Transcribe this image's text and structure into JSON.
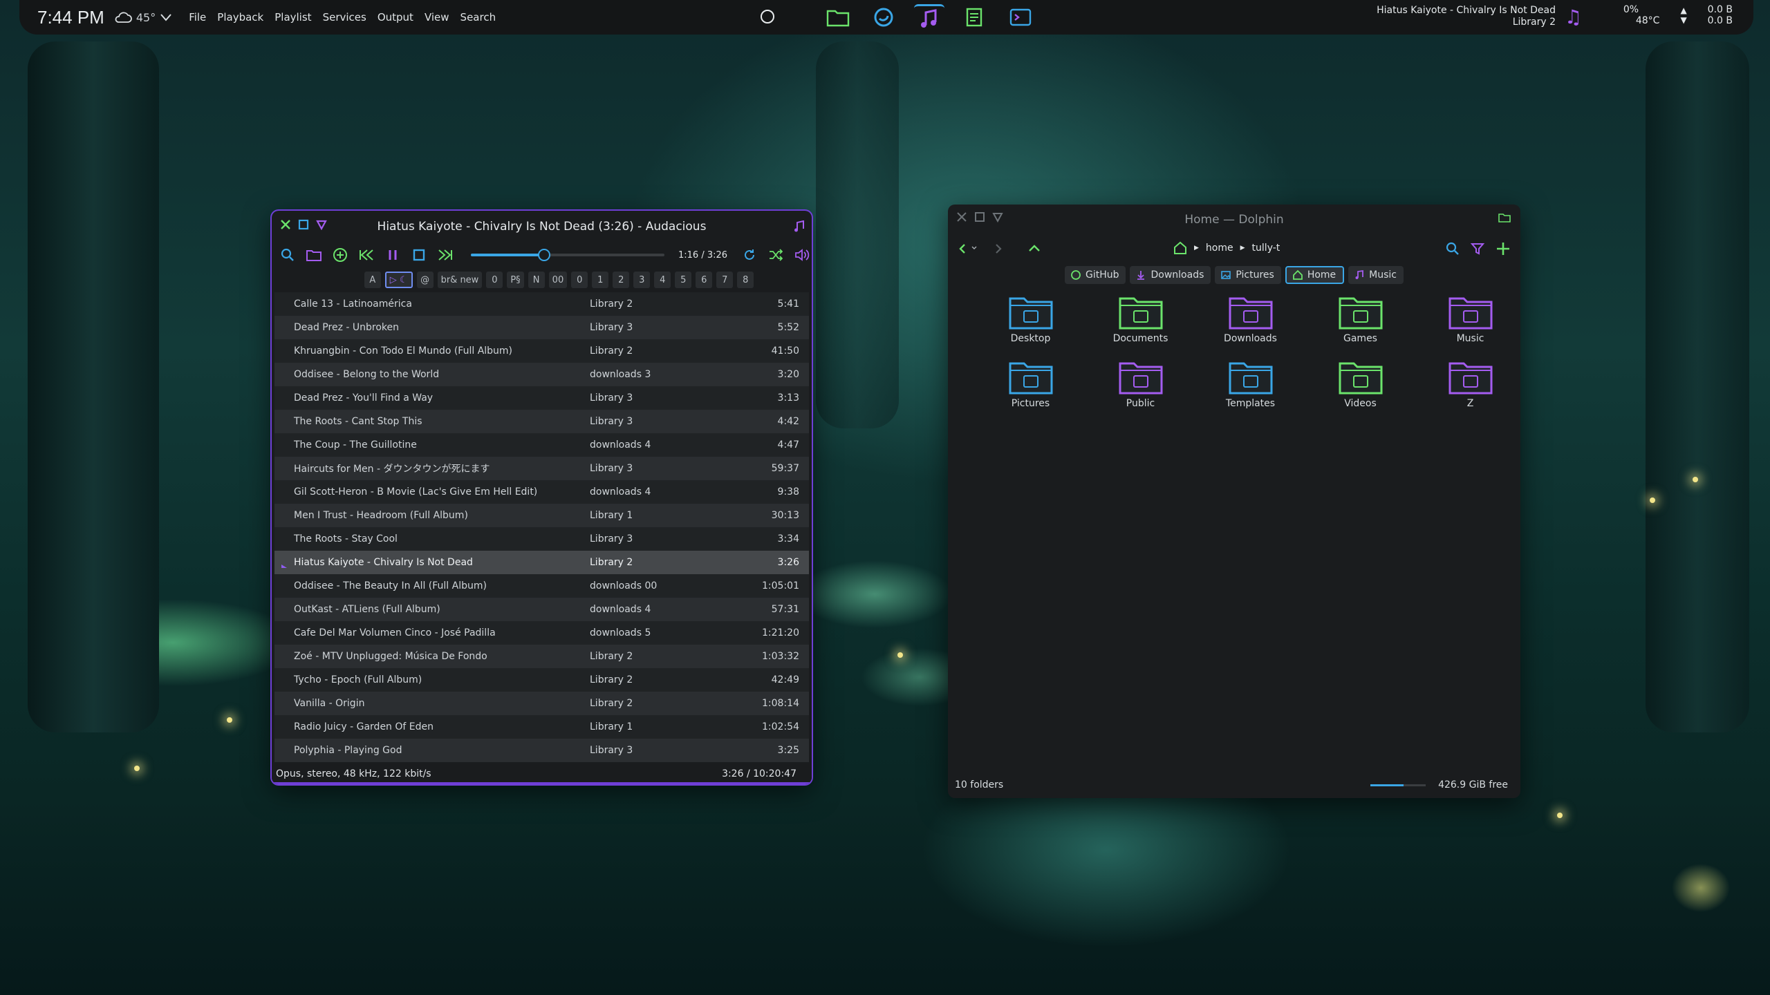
{
  "topbar": {
    "clock": "7:44 PM",
    "weather": "45°",
    "menus": [
      "File",
      "Playback",
      "Playlist",
      "Services",
      "Output",
      "View",
      "Search"
    ],
    "launchers": [
      "folder-icon",
      "browser-icon",
      "music-note-icon",
      "text-editor-icon",
      "terminal-icon"
    ],
    "now_playing_title": "Hiatus Kaiyote - Chivalry Is Not Dead",
    "now_playing_library": "Library 2",
    "cpu": "0%",
    "temp": "48°C",
    "net_up": "0.0 B",
    "net_down": "0.0 B"
  },
  "audacious": {
    "title": "Hiatus Kaiyote - Chivalry Is Not Dead (3:26) - Audacious",
    "time": "1:16 / 3:26",
    "progress_fraction": 0.37,
    "tabs": [
      "A",
      "▷ ☾",
      "@",
      "br& new",
      "0",
      "P§",
      "N",
      "00",
      "0",
      "1",
      "2",
      "3",
      "4",
      "5",
      "6",
      "7",
      "8"
    ],
    "active_tab": 1,
    "playlist": [
      {
        "title": "Calle 13 - Latinoamérica",
        "library": "Library 2",
        "length": "5:41"
      },
      {
        "title": "Dead Prez - Unbroken",
        "library": "Library 3",
        "length": "5:52"
      },
      {
        "title": "Khruangbin - Con Todo El Mundo (Full Album)",
        "library": "Library 2",
        "length": "41:50"
      },
      {
        "title": "Oddisee - Belong to the World",
        "library": "downloads 3",
        "length": "3:20"
      },
      {
        "title": "Dead Prez - You'll Find a Way",
        "library": "Library 3",
        "length": "3:13"
      },
      {
        "title": "The Roots - Cant Stop This",
        "library": "Library 3",
        "length": "4:42"
      },
      {
        "title": "The Coup - The Guillotine",
        "library": "downloads 4",
        "length": "4:47"
      },
      {
        "title": "Haircuts for Men - ダウンタウンが死にます",
        "library": "Library 3",
        "length": "59:37"
      },
      {
        "title": "Gil Scott-Heron - B Movie (Lac's Give Em Hell Edit)",
        "library": "downloads 4",
        "length": "9:38"
      },
      {
        "title": "Men I Trust - Headroom (Full Album)",
        "library": "Library 1",
        "length": "30:13"
      },
      {
        "title": "The Roots - Stay Cool",
        "library": "Library 3",
        "length": "3:34"
      },
      {
        "title": "Hiatus Kaiyote - Chivalry Is Not Dead",
        "library": "Library 2",
        "length": "3:26",
        "playing": true
      },
      {
        "title": "Oddisee - The Beauty In All (Full Album)",
        "library": "downloads 00",
        "length": "1:05:01"
      },
      {
        "title": "OutKast - ATLiens (Full Album)",
        "library": "downloads 4",
        "length": "57:31"
      },
      {
        "title": "Cafe Del Mar Volumen Cinco - José Padilla",
        "library": "downloads 5",
        "length": "1:21:20"
      },
      {
        "title": "Zoé - MTV Unplugged: Música De Fondo",
        "library": "Library 2",
        "length": "1:03:32"
      },
      {
        "title": "Tycho - Epoch (Full Album)",
        "library": "Library 2",
        "length": "42:49"
      },
      {
        "title": "Vanilla - Origin",
        "library": "Library 2",
        "length": "1:08:14"
      },
      {
        "title": "Radio Juicy - Garden Of Eden",
        "library": "Library 1",
        "length": "1:02:54"
      },
      {
        "title": "Polyphia - Playing God",
        "library": "Library 3",
        "length": "3:25"
      }
    ],
    "status_left": "Opus, stereo, 48 kHz, 122 kbit/s",
    "status_right": "3:26 / 10:20:47"
  },
  "dolphin": {
    "title": "Home — Dolphin",
    "breadcrumb": [
      "home",
      "tully-t"
    ],
    "places": [
      {
        "label": "GitHub",
        "icon": "github-icon"
      },
      {
        "label": "Downloads",
        "icon": "download-icon"
      },
      {
        "label": "Pictures",
        "icon": "picture-icon"
      },
      {
        "label": "Home",
        "icon": "home-icon",
        "active": true
      },
      {
        "label": "Music",
        "icon": "music-note-icon"
      }
    ],
    "folders": [
      {
        "label": "Desktop",
        "color": "#3aa6e6"
      },
      {
        "label": "Documents",
        "color": "#6be36b"
      },
      {
        "label": "Downloads",
        "color": "#a45cf0"
      },
      {
        "label": "Games",
        "color": "#6be36b"
      },
      {
        "label": "Music",
        "color": "#a45cf0"
      },
      {
        "label": "Pictures",
        "color": "#3aa6e6"
      },
      {
        "label": "Public",
        "color": "#a45cf0"
      },
      {
        "label": "Templates",
        "color": "#3aa6e6"
      },
      {
        "label": "Videos",
        "color": "#6be36b"
      },
      {
        "label": "Z",
        "color": "#a45cf0"
      }
    ],
    "status_left": "10 folders",
    "status_right": "426.9 GiB free",
    "free_fraction": 0.6
  },
  "colors": {
    "accent_purple": "#a45cf0",
    "accent_blue": "#3aa6e6",
    "accent_green": "#6be36b"
  }
}
